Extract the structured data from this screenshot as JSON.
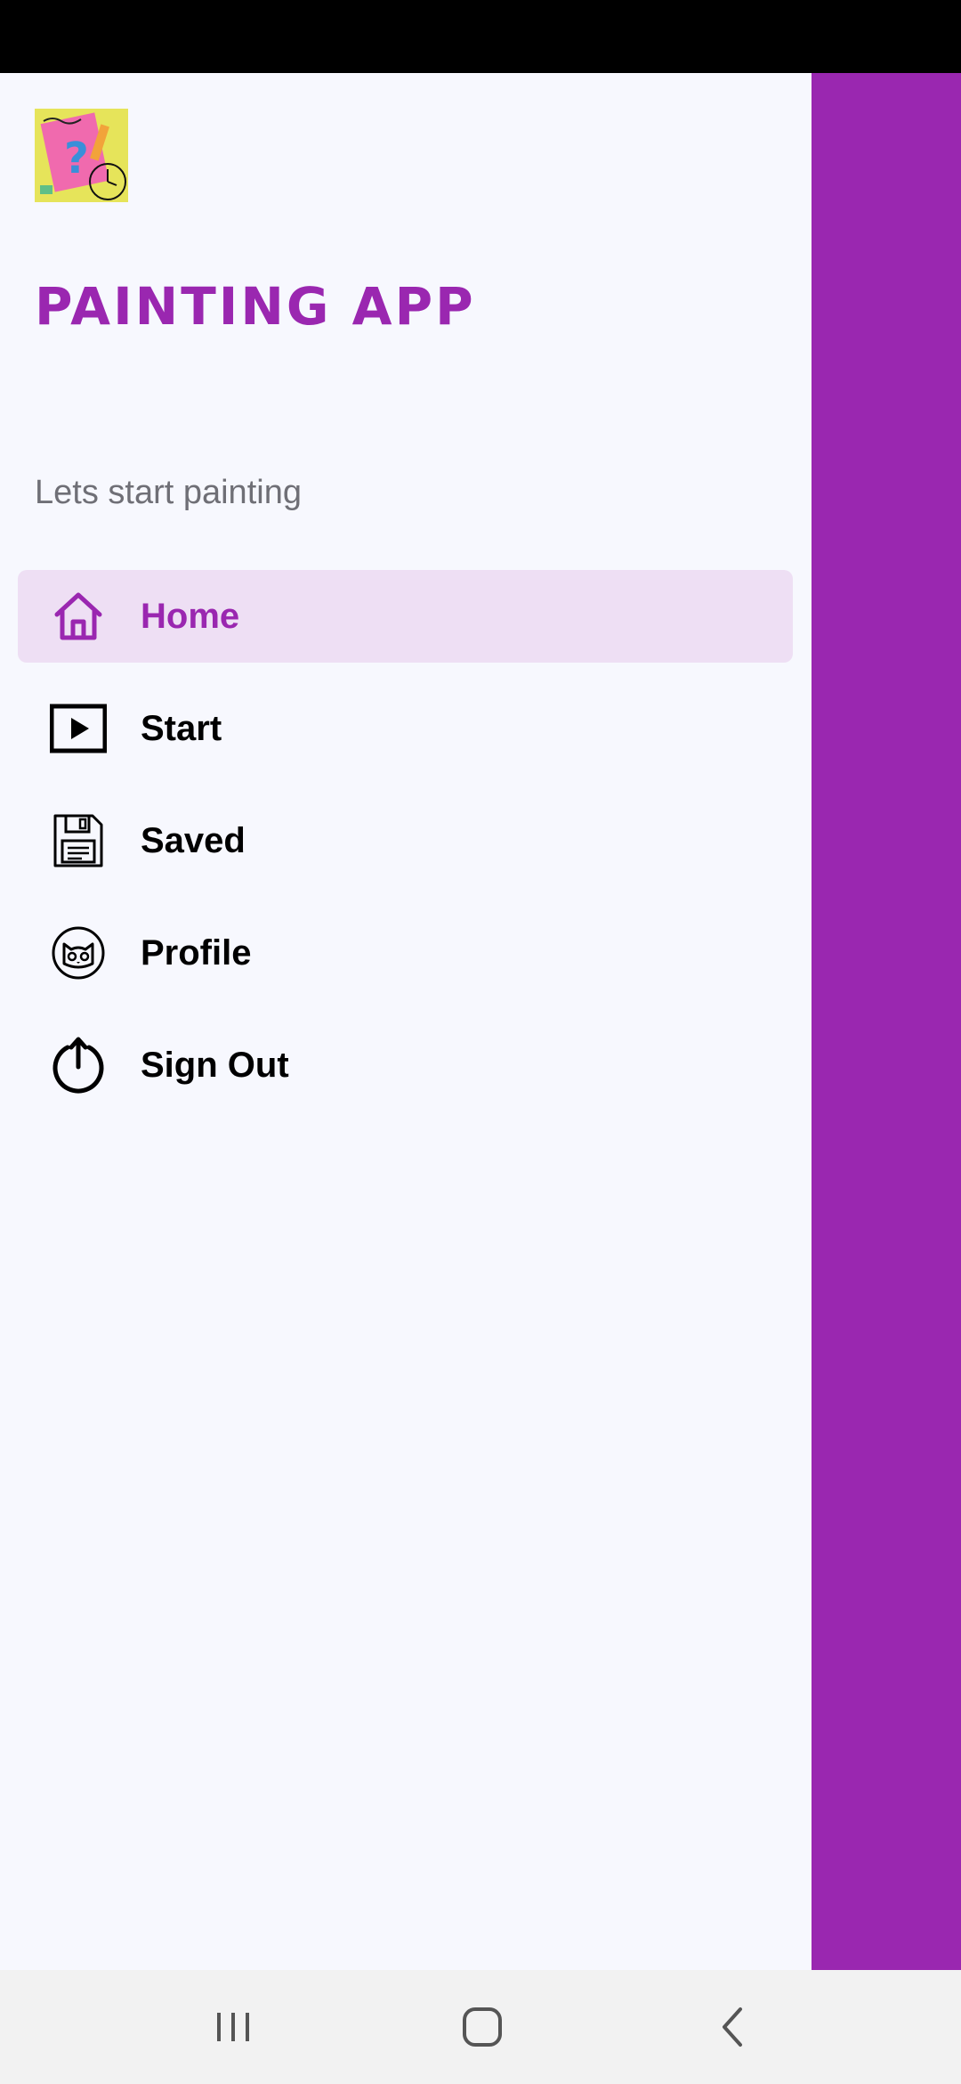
{
  "app": {
    "title": "PAINTING APP",
    "subtitle": "Lets start painting"
  },
  "theme": {
    "accent": "#9A27B0",
    "selected_bg": "#EEDFF4",
    "drawer_bg": "#F7F8FE"
  },
  "menu": {
    "items": [
      {
        "label": "Home",
        "icon": "home-icon",
        "selected": true
      },
      {
        "label": "Start",
        "icon": "play-icon",
        "selected": false
      },
      {
        "label": "Saved",
        "icon": "floppy-disk-icon",
        "selected": false
      },
      {
        "label": "Profile",
        "icon": "cat-face-icon",
        "selected": false
      },
      {
        "label": "Sign Out",
        "icon": "power-icon",
        "selected": false
      }
    ]
  },
  "navigation_bar": {
    "buttons": [
      "recent-apps-icon",
      "home-circle-icon",
      "back-icon"
    ]
  }
}
